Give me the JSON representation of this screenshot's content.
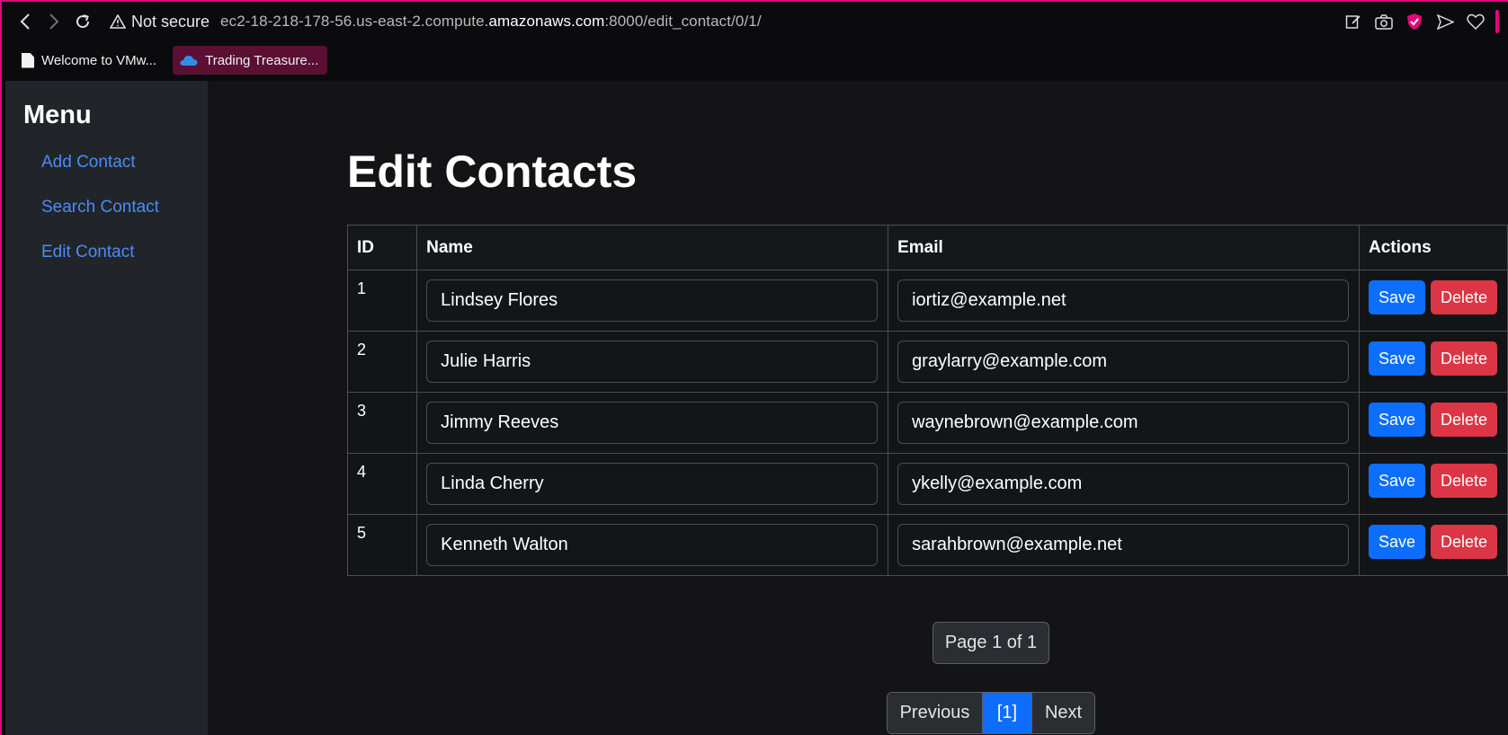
{
  "browser": {
    "security_label": "Not secure",
    "url_prefix": "ec2-18-218-178-56.us-east-2.compute.",
    "url_host": "amazonaws.com",
    "url_suffix": ":8000/edit_contact/0/1/",
    "bookmarks": [
      {
        "label": "Welcome to VMw...",
        "icon": "document-icon"
      },
      {
        "label": "Trading Treasure...",
        "icon": "cloud-icon"
      }
    ],
    "accent_color": "#e0087a"
  },
  "sidebar": {
    "title": "Menu",
    "links": [
      {
        "label": "Add Contact"
      },
      {
        "label": "Search Contact"
      },
      {
        "label": "Edit Contact"
      }
    ],
    "link_color": "#4a8cf7"
  },
  "main": {
    "title": "Edit Contacts",
    "columns": [
      "ID",
      "Name",
      "Email",
      "Actions"
    ],
    "rows": [
      {
        "id": "1",
        "name": "Lindsey Flores",
        "email": "iortiz@example.net"
      },
      {
        "id": "2",
        "name": "Julie Harris",
        "email": "graylarry@example.com"
      },
      {
        "id": "3",
        "name": "Jimmy Reeves",
        "email": "waynebrown@example.com"
      },
      {
        "id": "4",
        "name": "Linda Cherry",
        "email": "ykelly@example.com"
      },
      {
        "id": "5",
        "name": "Kenneth Walton",
        "email": "sarahbrown@example.net"
      }
    ],
    "save_label": "Save",
    "delete_label": "Delete",
    "save_color": "#0d6efd",
    "delete_color": "#dc3545"
  },
  "pagination": {
    "indicator": "Page 1 of 1",
    "previous_label": "Previous",
    "current_label": "[1]",
    "next_label": "Next"
  }
}
